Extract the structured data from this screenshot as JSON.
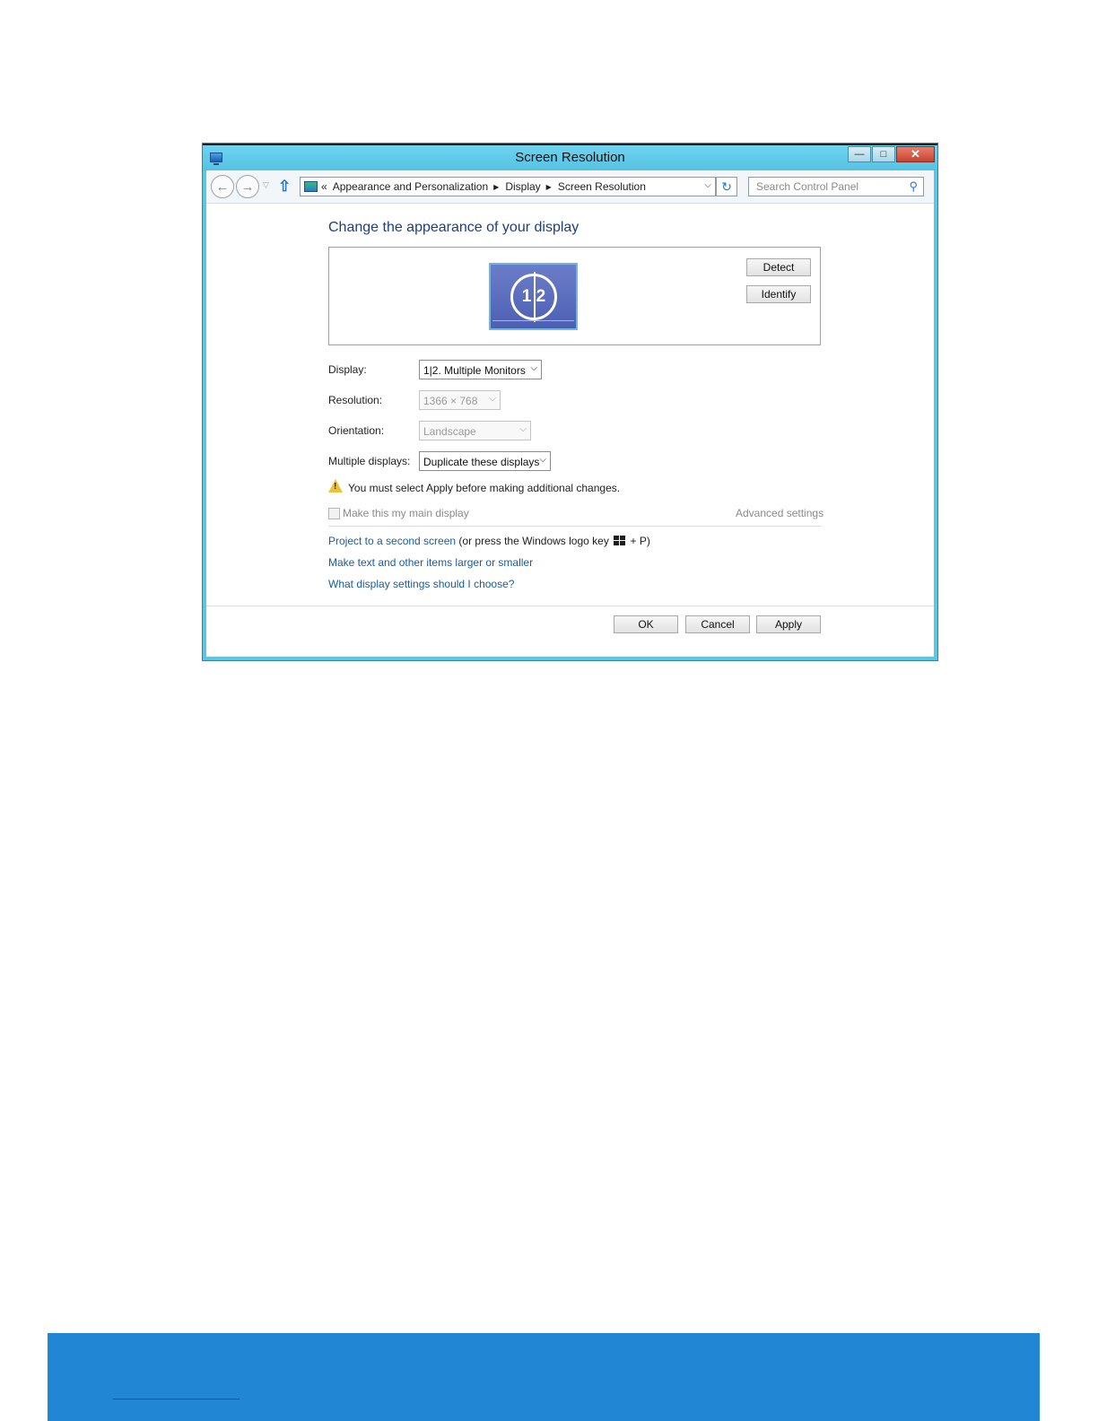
{
  "window": {
    "title": "Screen Resolution",
    "minimize": "—",
    "maximize": "□",
    "close": "✕"
  },
  "nav": {
    "back_icon": "←",
    "forward_icon": "→",
    "recent_icon": "▽",
    "up_icon": "⇧",
    "breadcrumb_prefix": "«",
    "breadcrumb": [
      "Appearance and Personalization",
      "Display",
      "Screen Resolution"
    ],
    "breadcrumb_separator": "▶",
    "dropdown_icon": "⌵",
    "refresh_icon": "↻",
    "search_placeholder": "Search Control Panel",
    "search_icon": "⚲"
  },
  "content": {
    "heading": "Change the appearance of your display",
    "monitor_label": "1 2",
    "detect": "Detect",
    "identify": "Identify",
    "display_label": "Display:",
    "display_value": "1|2. Multiple Monitors",
    "resolution_label": "Resolution:",
    "resolution_value": "1366 × 768",
    "orientation_label": "Orientation:",
    "orientation_value": "Landscape",
    "multiple_label": "Multiple displays:",
    "multiple_value": "Duplicate these displays",
    "warning": "You must select Apply before making additional changes.",
    "main_display": "Make this my main display",
    "advanced": "Advanced settings",
    "project_link": "Project to a second screen",
    "project_suffix_a": "(or press the Windows logo key",
    "project_suffix_b": "+ P)",
    "text_size_link": "Make text and other items larger or smaller",
    "settings_link": "What display settings should I choose?",
    "ok": "OK",
    "cancel": "Cancel",
    "apply": "Apply"
  },
  "colors": {
    "window_frame": "#5bc7e6",
    "link": "#1a5b9e",
    "heading": "#1e3f7d",
    "footer_band": "#2187d4"
  }
}
